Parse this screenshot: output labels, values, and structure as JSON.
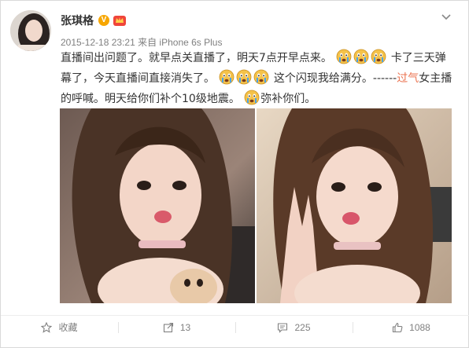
{
  "post": {
    "author": "张琪格",
    "verified_badge": "V",
    "time": "2015-12-18 23:21",
    "source": "来自 iPhone 6s Plus",
    "text": {
      "p1": "直播间出问题了。就早点关直播了，明天7点开早点来。",
      "p2": "卡了三天弹幕了，今天直播间直接消失了。",
      "p3": "这个闪现我给满分。------",
      "p4_red": "过气",
      "p5": "女主播的呼喊。明天给你们补个10级地震。",
      "p6": "弥补你们。"
    },
    "icons": {
      "avatar": "avatar",
      "verified": "verified-badge-icon",
      "member": "crown-icon",
      "menu": "chevron-down-icon",
      "emoticon": "crying-face-icon"
    }
  },
  "actions": {
    "favorite_label": "收藏",
    "repost_count": "13",
    "comment_count": "225",
    "like_count": "1088"
  },
  "colors": {
    "link_red": "#eb7350",
    "meta_gray": "#808080",
    "verified_orange": "#f7a600"
  }
}
